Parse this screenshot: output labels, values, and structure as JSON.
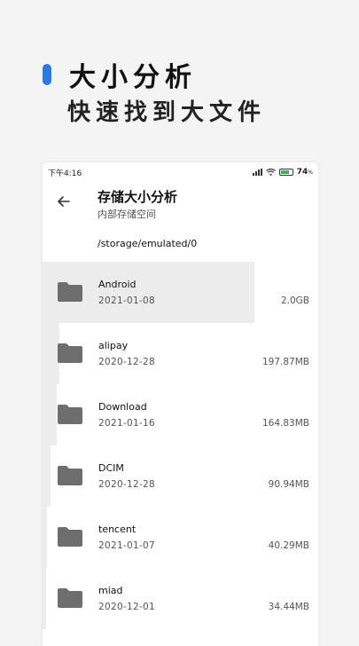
{
  "promo": {
    "title": "大小分析",
    "subtitle": "快速找到大文件",
    "accent_color": "#2a7ae4"
  },
  "status_bar": {
    "time": "下午4:16",
    "battery": "74",
    "battery_unit": "%"
  },
  "header": {
    "back_icon": "arrow-left-icon",
    "title": "存储大小分析",
    "subtitle": "内部存储空间"
  },
  "path": "/storage/emulated/0",
  "folders": [
    {
      "name": "Android",
      "date": "2021-01-08",
      "size": "2.0GB",
      "fraction": 0.77
    },
    {
      "name": "alipay",
      "date": "2020-12-28",
      "size": "197.87MB",
      "fraction": 0.06
    },
    {
      "name": "Download",
      "date": "2021-01-16",
      "size": "164.83MB",
      "fraction": 0.05
    },
    {
      "name": "DCIM",
      "date": "2020-12-28",
      "size": "90.94MB",
      "fraction": 0.03
    },
    {
      "name": "tencent",
      "date": "2021-01-07",
      "size": "40.29MB",
      "fraction": 0.015
    },
    {
      "name": "miad",
      "date": "2020-12-01",
      "size": "34.44MB",
      "fraction": 0.013
    }
  ]
}
